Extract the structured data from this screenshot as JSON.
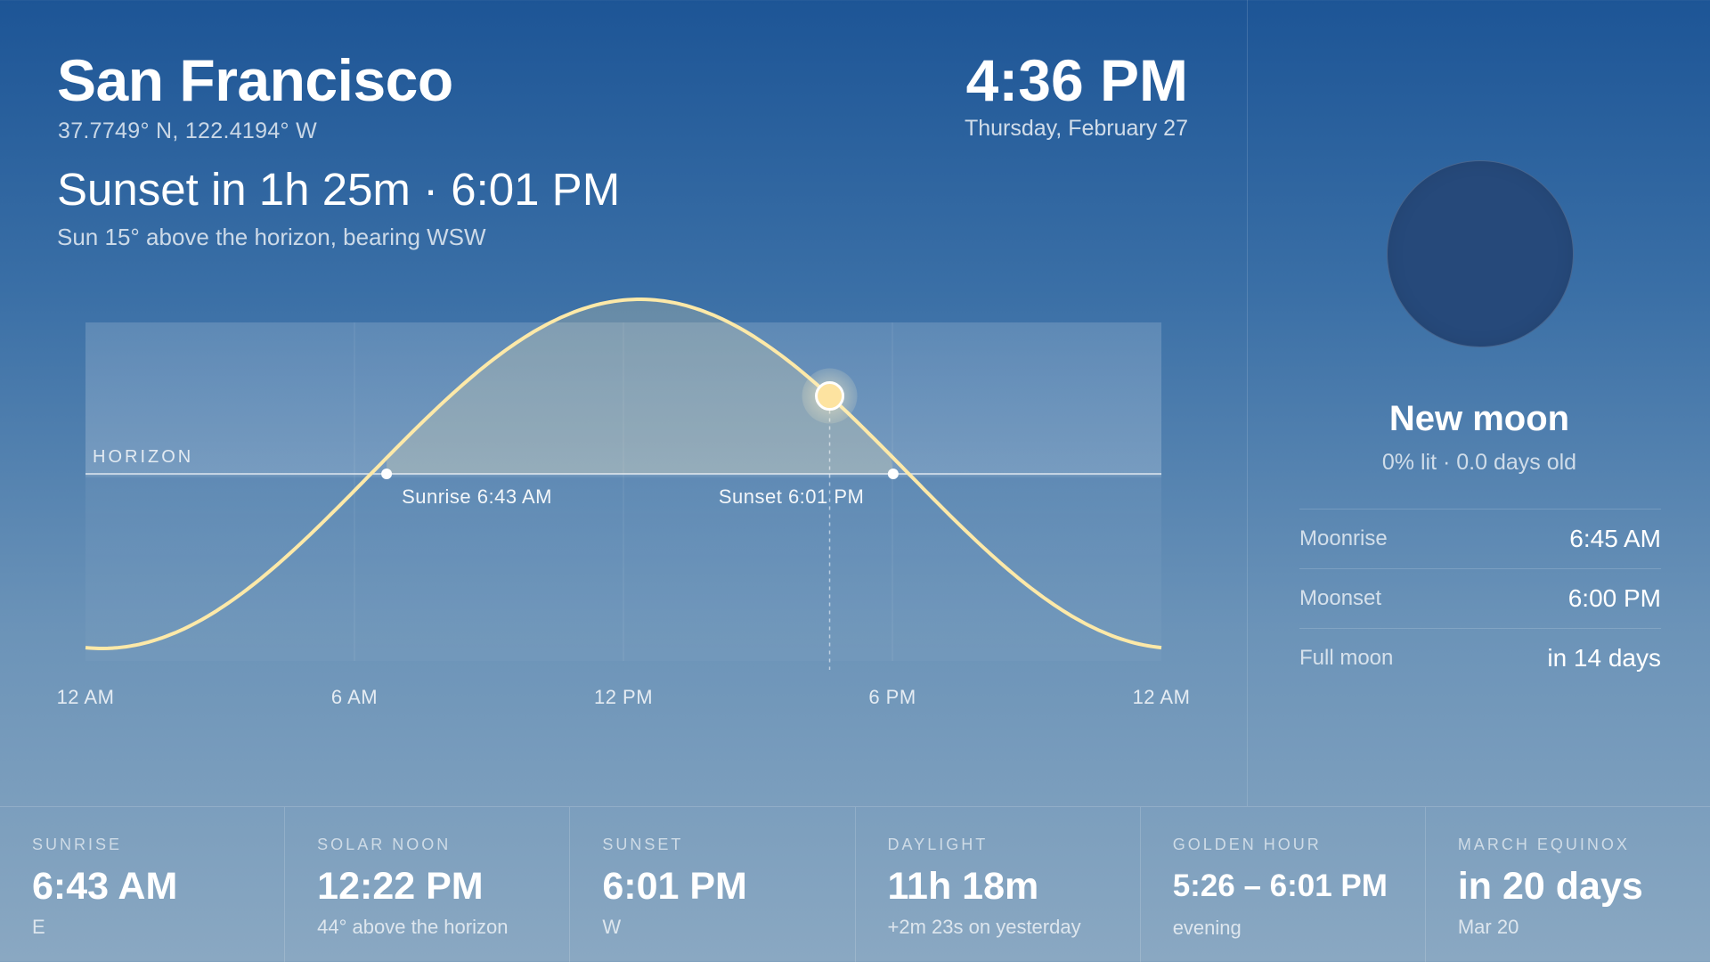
{
  "location": {
    "city": "San Francisco",
    "coordinates": "37.7749° N, 122.4194° W"
  },
  "time": {
    "clock": "4:36 PM",
    "date": "Thursday, February 27"
  },
  "summary": {
    "headline": "Sunset in 1h 25m · 6:01 PM",
    "sun_position": "Sun 15° above the horizon, bearing WSW"
  },
  "sun_chart": {
    "horizon_label": "HORIZON",
    "x_ticks": [
      "12 AM",
      "6 AM",
      "12 PM",
      "6 PM",
      "12 AM"
    ],
    "sunrise_label": "Sunrise 6:43 AM",
    "sunset_label": "Sunset 6:01 PM",
    "sunrise_hour": 6.717,
    "sunset_hour": 18.017,
    "solar_noon_hour": 12.367,
    "current_hour": 16.6,
    "curve_color": "#fde9a8",
    "sun_color": "#fde3a0"
  },
  "moon": {
    "phase": "New moon",
    "detail": "0% lit · 0.0 days old",
    "illumination": 0,
    "rows": [
      {
        "label": "Moonrise",
        "value": "6:45 AM"
      },
      {
        "label": "Moonset",
        "value": "6:00 PM"
      },
      {
        "label": "Full moon",
        "value": "in 14 days"
      }
    ]
  },
  "stats": [
    {
      "label": "SUNRISE",
      "value": "6:43 AM",
      "note": "E"
    },
    {
      "label": "SOLAR NOON",
      "value": "12:22 PM",
      "note": "44° above the horizon"
    },
    {
      "label": "SUNSET",
      "value": "6:01 PM",
      "note": "W"
    },
    {
      "label": "DAYLIGHT",
      "value": "11h 18m",
      "note": "+2m 23s on yesterday"
    },
    {
      "label": "GOLDEN HOUR",
      "value": "5:26 – 6:01 PM",
      "note": "evening"
    },
    {
      "label": "MARCH EQUINOX",
      "value": "in 20 days",
      "note": "Mar 20"
    }
  ]
}
